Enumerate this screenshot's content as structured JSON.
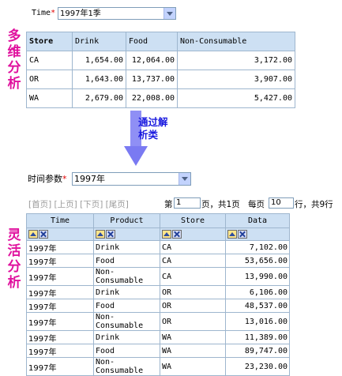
{
  "top_filter": {
    "label": "Time",
    "required_mark": "*",
    "value": "1997年1季"
  },
  "side_labels": {
    "top": [
      "多",
      "维",
      "分",
      "析"
    ],
    "bottom": [
      "灵",
      "活",
      "分",
      "析"
    ]
  },
  "top_table": {
    "headers": [
      "Store",
      "Drink",
      "Food",
      "Non-Consumable"
    ],
    "rows": [
      [
        "CA",
        "1,654.00",
        "12,064.00",
        "3,172.00"
      ],
      [
        "OR",
        "1,643.00",
        "13,737.00",
        "3,907.00"
      ],
      [
        "WA",
        "2,679.00",
        "22,008.00",
        "5,427.00"
      ]
    ]
  },
  "arrow_label": [
    "通过解",
    "析类"
  ],
  "bottom_filter": {
    "label": "时间参数",
    "required_mark": "*",
    "value": "1997年"
  },
  "pager": {
    "first": "[首页]",
    "prev": "[上页]",
    "next": "[下页]",
    "last": "[尾页]",
    "page_prefix": "第",
    "page_value": "1",
    "page_suffix": "页，共1页",
    "per_page_prefix": "每页",
    "per_page_value": "10",
    "per_page_suffix": "行，共9行"
  },
  "bottom_table": {
    "headers": [
      "Time",
      "Product",
      "Store",
      "Data"
    ],
    "rows": [
      [
        "1997年",
        "Drink",
        "CA",
        "7,102.00"
      ],
      [
        "1997年",
        "Food",
        "CA",
        "53,656.00"
      ],
      [
        "1997年",
        "Non-Consumable",
        "CA",
        "13,990.00"
      ],
      [
        "1997年",
        "Drink",
        "OR",
        "6,106.00"
      ],
      [
        "1997年",
        "Food",
        "OR",
        "48,537.00"
      ],
      [
        "1997年",
        "Non-Consumable",
        "OR",
        "13,016.00"
      ],
      [
        "1997年",
        "Drink",
        "WA",
        "11,389.00"
      ],
      [
        "1997年",
        "Food",
        "WA",
        "89,747.00"
      ],
      [
        "1997年",
        "Non-Consumable",
        "WA",
        "23,230.00"
      ]
    ]
  },
  "colors": {
    "side_label": "#e0119e",
    "arrow": "#8f8ff5",
    "arrow_label": "#1a1adf",
    "header_bg": "#cde0f3",
    "border": "#9eb6ce"
  }
}
